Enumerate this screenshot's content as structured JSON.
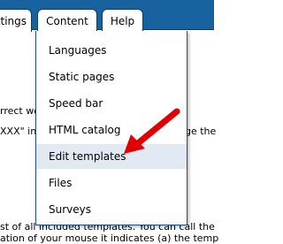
{
  "tabs": [
    {
      "label": "ttings"
    },
    {
      "label": "Content"
    },
    {
      "label": "Help"
    }
  ],
  "menu": {
    "items": [
      {
        "label": "Languages"
      },
      {
        "label": "Static pages"
      },
      {
        "label": "Speed bar"
      },
      {
        "label": "HTML catalog"
      },
      {
        "label": "Edit templates"
      },
      {
        "label": "Files"
      },
      {
        "label": "Surveys"
      }
    ],
    "highlighted_item": "Edit templates",
    "highlight_color": "#e2e9f3"
  },
  "background_text": {
    "line1": "rrect wo",
    "line2": "XXX\" in",
    "line2_right": "nge the",
    "line3": "st of all included templates. You can call the",
    "line4": "ation of your mouse it indicates (a) the temp"
  },
  "colors": {
    "tabbar": "#18639f",
    "arrow": "#e00000"
  },
  "icons": {
    "arrow": "red-pointer-arrow"
  }
}
